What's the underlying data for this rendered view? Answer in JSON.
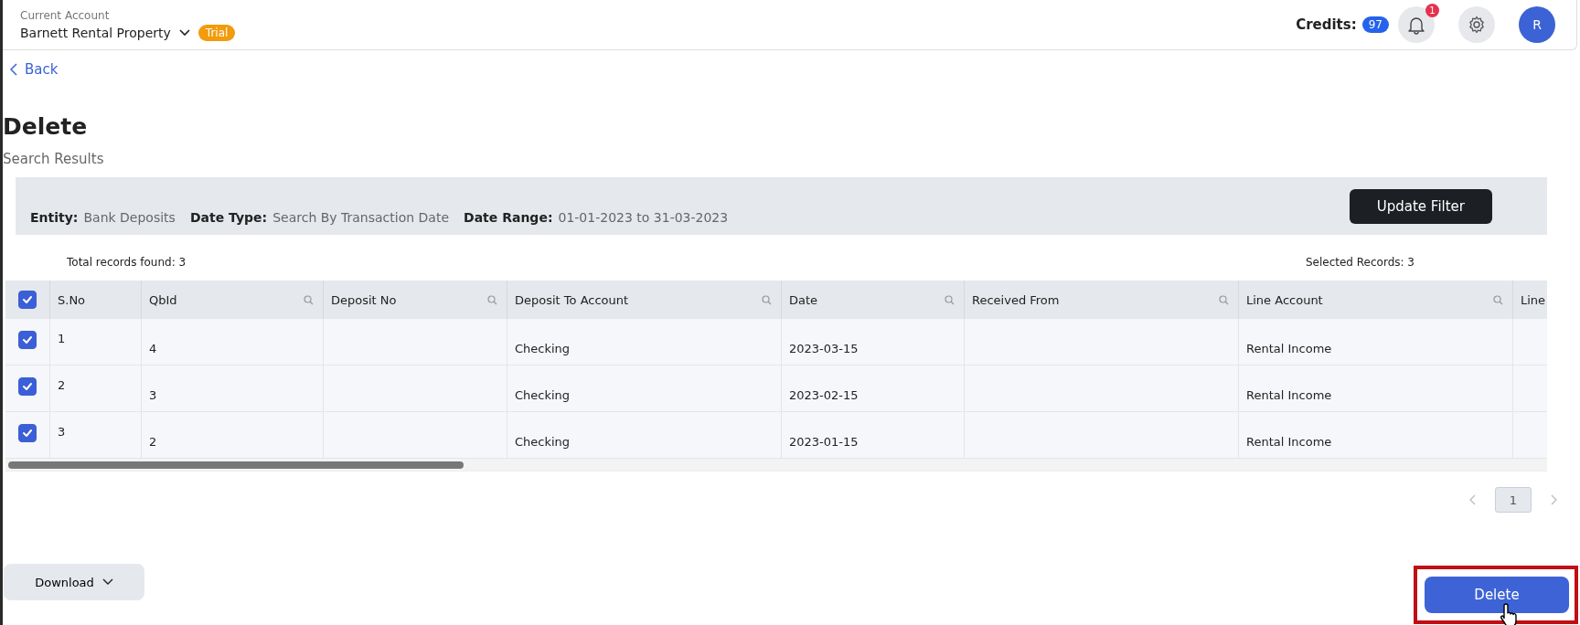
{
  "header": {
    "account_label": "Current Account",
    "account_name": "Barnett Rental Property",
    "plan_badge": "Trial",
    "credits_label": "Credits:",
    "credits_count": "97",
    "notification_count": "1",
    "avatar_initial": "R"
  },
  "back_link": "Back",
  "page_title": "Delete",
  "subtitle": "Search Results",
  "filter": {
    "items": [
      {
        "label": "Entity:",
        "value": "Bank Deposits"
      },
      {
        "label": "Date Type:",
        "value": "Search By Transaction Date"
      },
      {
        "label": "Date Range:",
        "value": "01-01-2023 to 31-03-2023"
      }
    ],
    "button": "Update Filter"
  },
  "total_records": "Total records found: 3",
  "selected_records": "Selected Records: 3",
  "table": {
    "all_checked": true,
    "columns": [
      {
        "label": "S.No",
        "filterable": false
      },
      {
        "label": "QbId",
        "filterable": true
      },
      {
        "label": "Deposit No",
        "filterable": true
      },
      {
        "label": "Deposit To Account",
        "filterable": true
      },
      {
        "label": "Date",
        "filterable": true
      },
      {
        "label": "Received From",
        "filterable": true
      },
      {
        "label": "Line Account",
        "filterable": true
      },
      {
        "label": "Line"
      }
    ],
    "rows": [
      {
        "checked": true,
        "cells": [
          "1",
          "4",
          "",
          "Checking",
          "2023-03-15",
          "",
          "Rental Income",
          ""
        ]
      },
      {
        "checked": true,
        "cells": [
          "2",
          "3",
          "",
          "Checking",
          "2023-02-15",
          "",
          "Rental Income",
          ""
        ]
      },
      {
        "checked": true,
        "cells": [
          "3",
          "2",
          "",
          "Checking",
          "2023-01-15",
          "",
          "Rental Income",
          ""
        ]
      }
    ]
  },
  "pagination": {
    "pages": [
      {
        "label": "1",
        "selected": true
      }
    ]
  },
  "download_button": "Download",
  "delete_button": "Delete"
}
